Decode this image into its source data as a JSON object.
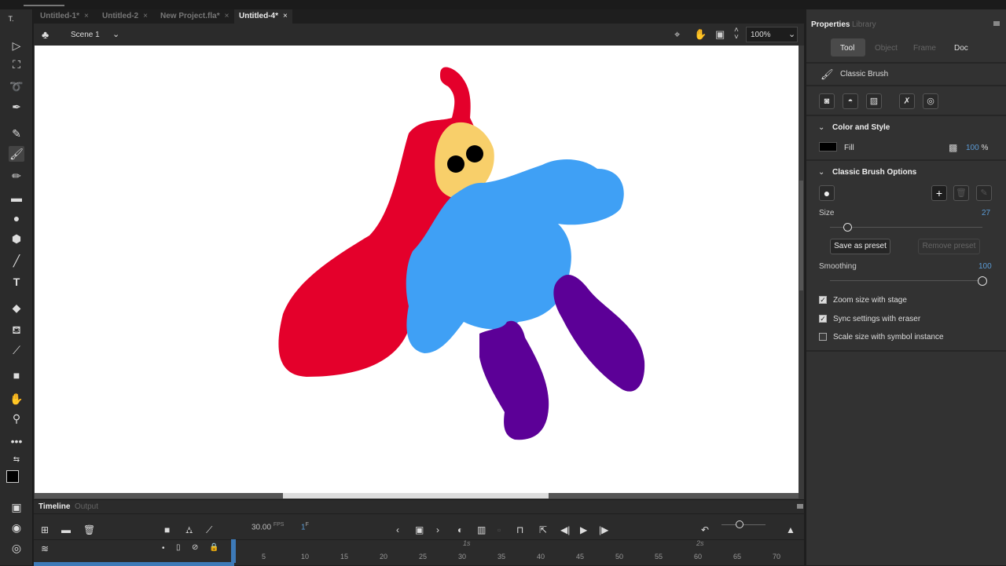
{
  "tabs": [
    {
      "label": "Untitled-1*"
    },
    {
      "label": "Untitled-2"
    },
    {
      "label": "New Project.fla*"
    },
    {
      "label": "Untitled-4*",
      "active": true
    }
  ],
  "tab_close": "×",
  "scene": {
    "label": "Scene 1",
    "zoom": "100%"
  },
  "timeline": {
    "tabs": [
      "Timeline",
      "Output"
    ],
    "fps": "30.00",
    "fps_unit": "FPS",
    "frame": "1",
    "frame_unit": "F",
    "seconds": [
      "1s",
      "2s"
    ],
    "ticks": [
      "5",
      "10",
      "15",
      "20",
      "25",
      "30",
      "35",
      "40",
      "45",
      "50",
      "55",
      "60",
      "65",
      "70"
    ]
  },
  "panel": {
    "tabs": [
      "Properties",
      "Library"
    ],
    "subtabs": [
      "Tool",
      "Object",
      "Frame",
      "Doc"
    ],
    "tool_name": "Classic Brush",
    "color_style": {
      "title": "Color and Style",
      "fill_label": "Fill",
      "fill_color": "#000000",
      "alpha": "100",
      "alpha_unit": "%"
    },
    "brush_options": {
      "title": "Classic Brush Options",
      "size_label": "Size",
      "size": "27",
      "size_fraction": 0.27,
      "save_preset": "Save as preset",
      "remove_preset": "Remove preset",
      "smoothing_label": "Smoothing",
      "smoothing": "100",
      "smoothing_fraction": 1.0,
      "checkboxes": [
        {
          "label": "Zoom size with stage",
          "checked": true
        },
        {
          "label": "Sync settings with eraser",
          "checked": true
        },
        {
          "label": "Scale size with symbol instance",
          "checked": false
        }
      ]
    }
  },
  "colors": {
    "red": "#e4002b",
    "yellow": "#f8cf6a",
    "blue": "#3fa0f5",
    "purple": "#5c0097"
  }
}
